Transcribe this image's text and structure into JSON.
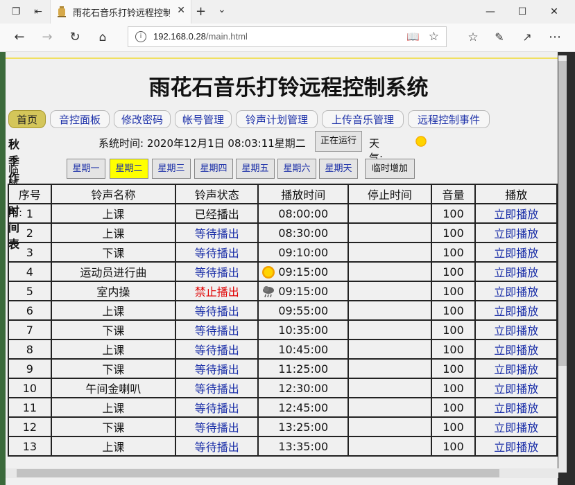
{
  "browser": {
    "tab_title": "雨花石音乐打铃远程控制",
    "url_host": "192.168.0.28",
    "url_path": "/main.html"
  },
  "page": {
    "title": "雨花石音乐打铃远程控制系统",
    "nav_tabs": [
      "首页",
      "音控面板",
      "修改密码",
      "帐号管理",
      "铃声计划管理",
      "上传音乐管理",
      "远程控制事件"
    ],
    "active_tab": "首页",
    "season": "秋季作息时间表",
    "system_time_label": "系统时间:",
    "system_time": "2020年12月1日 08:03:11星期二",
    "run_button": "正在运行",
    "weather_label": "天气:",
    "weather_icon": "sunny-icon",
    "temp_label": "临时调用:",
    "day_buttons": [
      "星期一",
      "星期二",
      "星期三",
      "星期四",
      "星期五",
      "星期六",
      "星期天"
    ],
    "active_day": "星期二",
    "add_button": "临时增加",
    "table_headers": [
      "序号",
      "铃声名称",
      "铃声状态",
      "播放时间",
      "停止时间",
      "音量",
      "播放"
    ],
    "rows": [
      {
        "no": "1",
        "name": "上课",
        "status": "已经播出",
        "status_type": "done",
        "time": "08:00:00",
        "stop": "",
        "volume": "100",
        "action": "立即播放",
        "icon": ""
      },
      {
        "no": "2",
        "name": "上课",
        "status": "等待播出",
        "status_type": "wait",
        "time": "08:30:00",
        "stop": "",
        "volume": "100",
        "action": "立即播放",
        "icon": ""
      },
      {
        "no": "3",
        "name": "下课",
        "status": "等待播出",
        "status_type": "wait",
        "time": "09:10:00",
        "stop": "",
        "volume": "100",
        "action": "立即播放",
        "icon": ""
      },
      {
        "no": "4",
        "name": "运动员进行曲",
        "status": "等待播出",
        "status_type": "wait",
        "time": "09:15:00",
        "stop": "",
        "volume": "100",
        "action": "立即播放",
        "icon": "sunny-icon"
      },
      {
        "no": "5",
        "name": "室内操",
        "status": "禁止播出",
        "status_type": "ban",
        "time": "09:15:00",
        "stop": "",
        "volume": "100",
        "action": "立即播放",
        "icon": "rain-cloud-icon"
      },
      {
        "no": "6",
        "name": "上课",
        "status": "等待播出",
        "status_type": "wait",
        "time": "09:55:00",
        "stop": "",
        "volume": "100",
        "action": "立即播放",
        "icon": ""
      },
      {
        "no": "7",
        "name": "下课",
        "status": "等待播出",
        "status_type": "wait",
        "time": "10:35:00",
        "stop": "",
        "volume": "100",
        "action": "立即播放",
        "icon": ""
      },
      {
        "no": "8",
        "name": "上课",
        "status": "等待播出",
        "status_type": "wait",
        "time": "10:45:00",
        "stop": "",
        "volume": "100",
        "action": "立即播放",
        "icon": ""
      },
      {
        "no": "9",
        "name": "下课",
        "status": "等待播出",
        "status_type": "wait",
        "time": "11:25:00",
        "stop": "",
        "volume": "100",
        "action": "立即播放",
        "icon": ""
      },
      {
        "no": "10",
        "name": "午间金喇叭",
        "status": "等待播出",
        "status_type": "wait",
        "time": "12:30:00",
        "stop": "",
        "volume": "100",
        "action": "立即播放",
        "icon": ""
      },
      {
        "no": "11",
        "name": "上课",
        "status": "等待播出",
        "status_type": "wait",
        "time": "12:45:00",
        "stop": "",
        "volume": "100",
        "action": "立即播放",
        "icon": ""
      },
      {
        "no": "12",
        "name": "下课",
        "status": "等待播出",
        "status_type": "wait",
        "time": "13:25:00",
        "stop": "",
        "volume": "100",
        "action": "立即播放",
        "icon": ""
      },
      {
        "no": "13",
        "name": "上课",
        "status": "等待播出",
        "status_type": "wait",
        "time": "13:35:00",
        "stop": "",
        "volume": "100",
        "action": "立即播放",
        "icon": ""
      }
    ]
  },
  "colors": {
    "link": "#1b2fa8",
    "banned": "#e00000",
    "active_day": "#ffff00",
    "active_tab": "#d4c65a"
  }
}
